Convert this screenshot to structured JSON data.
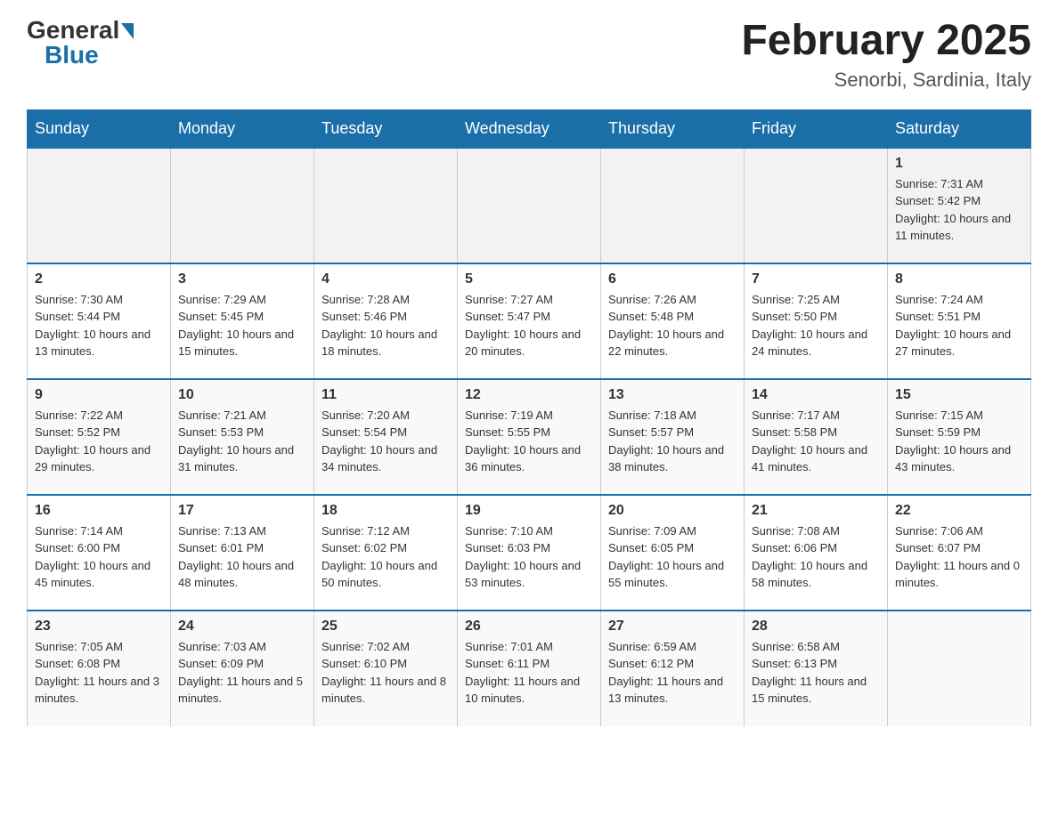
{
  "logo": {
    "general": "General",
    "blue": "Blue"
  },
  "calendar": {
    "title": "February 2025",
    "subtitle": "Senorbi, Sardinia, Italy"
  },
  "days_of_week": [
    "Sunday",
    "Monday",
    "Tuesday",
    "Wednesday",
    "Thursday",
    "Friday",
    "Saturday"
  ],
  "weeks": [
    [
      {
        "day": "",
        "info": ""
      },
      {
        "day": "",
        "info": ""
      },
      {
        "day": "",
        "info": ""
      },
      {
        "day": "",
        "info": ""
      },
      {
        "day": "",
        "info": ""
      },
      {
        "day": "",
        "info": ""
      },
      {
        "day": "1",
        "info": "Sunrise: 7:31 AM\nSunset: 5:42 PM\nDaylight: 10 hours and 11 minutes."
      }
    ],
    [
      {
        "day": "2",
        "info": "Sunrise: 7:30 AM\nSunset: 5:44 PM\nDaylight: 10 hours and 13 minutes."
      },
      {
        "day": "3",
        "info": "Sunrise: 7:29 AM\nSunset: 5:45 PM\nDaylight: 10 hours and 15 minutes."
      },
      {
        "day": "4",
        "info": "Sunrise: 7:28 AM\nSunset: 5:46 PM\nDaylight: 10 hours and 18 minutes."
      },
      {
        "day": "5",
        "info": "Sunrise: 7:27 AM\nSunset: 5:47 PM\nDaylight: 10 hours and 20 minutes."
      },
      {
        "day": "6",
        "info": "Sunrise: 7:26 AM\nSunset: 5:48 PM\nDaylight: 10 hours and 22 minutes."
      },
      {
        "day": "7",
        "info": "Sunrise: 7:25 AM\nSunset: 5:50 PM\nDaylight: 10 hours and 24 minutes."
      },
      {
        "day": "8",
        "info": "Sunrise: 7:24 AM\nSunset: 5:51 PM\nDaylight: 10 hours and 27 minutes."
      }
    ],
    [
      {
        "day": "9",
        "info": "Sunrise: 7:22 AM\nSunset: 5:52 PM\nDaylight: 10 hours and 29 minutes."
      },
      {
        "day": "10",
        "info": "Sunrise: 7:21 AM\nSunset: 5:53 PM\nDaylight: 10 hours and 31 minutes."
      },
      {
        "day": "11",
        "info": "Sunrise: 7:20 AM\nSunset: 5:54 PM\nDaylight: 10 hours and 34 minutes."
      },
      {
        "day": "12",
        "info": "Sunrise: 7:19 AM\nSunset: 5:55 PM\nDaylight: 10 hours and 36 minutes."
      },
      {
        "day": "13",
        "info": "Sunrise: 7:18 AM\nSunset: 5:57 PM\nDaylight: 10 hours and 38 minutes."
      },
      {
        "day": "14",
        "info": "Sunrise: 7:17 AM\nSunset: 5:58 PM\nDaylight: 10 hours and 41 minutes."
      },
      {
        "day": "15",
        "info": "Sunrise: 7:15 AM\nSunset: 5:59 PM\nDaylight: 10 hours and 43 minutes."
      }
    ],
    [
      {
        "day": "16",
        "info": "Sunrise: 7:14 AM\nSunset: 6:00 PM\nDaylight: 10 hours and 45 minutes."
      },
      {
        "day": "17",
        "info": "Sunrise: 7:13 AM\nSunset: 6:01 PM\nDaylight: 10 hours and 48 minutes."
      },
      {
        "day": "18",
        "info": "Sunrise: 7:12 AM\nSunset: 6:02 PM\nDaylight: 10 hours and 50 minutes."
      },
      {
        "day": "19",
        "info": "Sunrise: 7:10 AM\nSunset: 6:03 PM\nDaylight: 10 hours and 53 minutes."
      },
      {
        "day": "20",
        "info": "Sunrise: 7:09 AM\nSunset: 6:05 PM\nDaylight: 10 hours and 55 minutes."
      },
      {
        "day": "21",
        "info": "Sunrise: 7:08 AM\nSunset: 6:06 PM\nDaylight: 10 hours and 58 minutes."
      },
      {
        "day": "22",
        "info": "Sunrise: 7:06 AM\nSunset: 6:07 PM\nDaylight: 11 hours and 0 minutes."
      }
    ],
    [
      {
        "day": "23",
        "info": "Sunrise: 7:05 AM\nSunset: 6:08 PM\nDaylight: 11 hours and 3 minutes."
      },
      {
        "day": "24",
        "info": "Sunrise: 7:03 AM\nSunset: 6:09 PM\nDaylight: 11 hours and 5 minutes."
      },
      {
        "day": "25",
        "info": "Sunrise: 7:02 AM\nSunset: 6:10 PM\nDaylight: 11 hours and 8 minutes."
      },
      {
        "day": "26",
        "info": "Sunrise: 7:01 AM\nSunset: 6:11 PM\nDaylight: 11 hours and 10 minutes."
      },
      {
        "day": "27",
        "info": "Sunrise: 6:59 AM\nSunset: 6:12 PM\nDaylight: 11 hours and 13 minutes."
      },
      {
        "day": "28",
        "info": "Sunrise: 6:58 AM\nSunset: 6:13 PM\nDaylight: 11 hours and 15 minutes."
      },
      {
        "day": "",
        "info": ""
      }
    ]
  ]
}
